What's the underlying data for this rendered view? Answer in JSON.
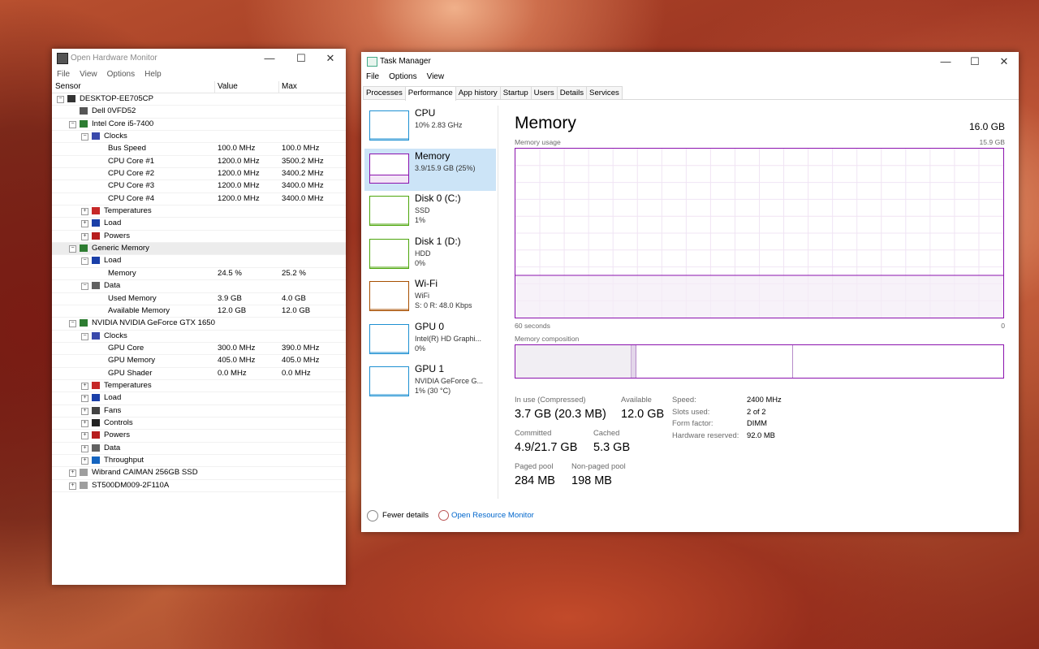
{
  "ohm": {
    "title": "Open Hardware Monitor",
    "menu": [
      "File",
      "View",
      "Options",
      "Help"
    ],
    "columns": {
      "sensor": "Sensor",
      "value": "Value",
      "max": "Max"
    },
    "rows": [
      {
        "label": "DESKTOP-EE705CP",
        "value": "",
        "max": "",
        "depth": 0,
        "exp": "⊟",
        "icon": "computer-icon",
        "color": "#333333"
      },
      {
        "label": "Dell 0VFD52",
        "value": "",
        "max": "",
        "depth": 1,
        "exp": "",
        "icon": "motherboard-icon",
        "color": "#555555"
      },
      {
        "label": "Intel Core i5-7400",
        "value": "",
        "max": "",
        "depth": 1,
        "exp": "⊟",
        "icon": "cpu-icon",
        "color": "#2e7d32"
      },
      {
        "label": "Clocks",
        "value": "",
        "max": "",
        "depth": 2,
        "exp": "⊟",
        "icon": "clock-icon",
        "color": "#3949ab"
      },
      {
        "label": "Bus Speed",
        "value": "100.0 MHz",
        "max": "100.0 MHz",
        "depth": 3,
        "exp": "",
        "icon": "",
        "color": ""
      },
      {
        "label": "CPU Core #1",
        "value": "1200.0 MHz",
        "max": "3500.2 MHz",
        "depth": 3,
        "exp": "",
        "icon": "",
        "color": ""
      },
      {
        "label": "CPU Core #2",
        "value": "1200.0 MHz",
        "max": "3400.2 MHz",
        "depth": 3,
        "exp": "",
        "icon": "",
        "color": ""
      },
      {
        "label": "CPU Core #3",
        "value": "1200.0 MHz",
        "max": "3400.0 MHz",
        "depth": 3,
        "exp": "",
        "icon": "",
        "color": ""
      },
      {
        "label": "CPU Core #4",
        "value": "1200.0 MHz",
        "max": "3400.0 MHz",
        "depth": 3,
        "exp": "",
        "icon": "",
        "color": ""
      },
      {
        "label": "Temperatures",
        "value": "",
        "max": "",
        "depth": 2,
        "exp": "⊞",
        "icon": "thermometer-icon",
        "color": "#c62828"
      },
      {
        "label": "Load",
        "value": "",
        "max": "",
        "depth": 2,
        "exp": "⊞",
        "icon": "load-icon",
        "color": "#1a3fa8"
      },
      {
        "label": "Powers",
        "value": "",
        "max": "",
        "depth": 2,
        "exp": "⊞",
        "icon": "power-icon",
        "color": "#b71c1c"
      },
      {
        "label": "Generic Memory",
        "value": "",
        "max": "",
        "depth": 1,
        "exp": "⊟",
        "icon": "ram-icon",
        "color": "#2e7d32",
        "selected": true
      },
      {
        "label": "Load",
        "value": "",
        "max": "",
        "depth": 2,
        "exp": "⊟",
        "icon": "load-icon",
        "color": "#1a3fa8"
      },
      {
        "label": "Memory",
        "value": "24.5 %",
        "max": "25.2 %",
        "depth": 3,
        "exp": "",
        "icon": "",
        "color": ""
      },
      {
        "label": "Data",
        "value": "",
        "max": "",
        "depth": 2,
        "exp": "⊟",
        "icon": "data-icon",
        "color": "#616161"
      },
      {
        "label": "Used Memory",
        "value": "3.9 GB",
        "max": "4.0 GB",
        "depth": 3,
        "exp": "",
        "icon": "",
        "color": ""
      },
      {
        "label": "Available Memory",
        "value": "12.0 GB",
        "max": "12.0 GB",
        "depth": 3,
        "exp": "",
        "icon": "",
        "color": ""
      },
      {
        "label": "NVIDIA NVIDIA GeForce GTX 1650",
        "value": "",
        "max": "",
        "depth": 1,
        "exp": "⊟",
        "icon": "gpu-icon",
        "color": "#2e7d32"
      },
      {
        "label": "Clocks",
        "value": "",
        "max": "",
        "depth": 2,
        "exp": "⊟",
        "icon": "clock-icon",
        "color": "#3949ab"
      },
      {
        "label": "GPU Core",
        "value": "300.0 MHz",
        "max": "390.0 MHz",
        "depth": 3,
        "exp": "",
        "icon": "",
        "color": ""
      },
      {
        "label": "GPU Memory",
        "value": "405.0 MHz",
        "max": "405.0 MHz",
        "depth": 3,
        "exp": "",
        "icon": "",
        "color": ""
      },
      {
        "label": "GPU Shader",
        "value": "0.0 MHz",
        "max": "0.0 MHz",
        "depth": 3,
        "exp": "",
        "icon": "",
        "color": ""
      },
      {
        "label": "Temperatures",
        "value": "",
        "max": "",
        "depth": 2,
        "exp": "⊞",
        "icon": "thermometer-icon",
        "color": "#c62828"
      },
      {
        "label": "Load",
        "value": "",
        "max": "",
        "depth": 2,
        "exp": "⊞",
        "icon": "load-icon",
        "color": "#1a3fa8"
      },
      {
        "label": "Fans",
        "value": "",
        "max": "",
        "depth": 2,
        "exp": "⊞",
        "icon": "fan-icon",
        "color": "#424242"
      },
      {
        "label": "Controls",
        "value": "",
        "max": "",
        "depth": 2,
        "exp": "⊞",
        "icon": "control-icon",
        "color": "#212121"
      },
      {
        "label": "Powers",
        "value": "",
        "max": "",
        "depth": 2,
        "exp": "⊞",
        "icon": "power-icon",
        "color": "#b71c1c"
      },
      {
        "label": "Data",
        "value": "",
        "max": "",
        "depth": 2,
        "exp": "⊞",
        "icon": "data-icon",
        "color": "#616161"
      },
      {
        "label": "Throughput",
        "value": "",
        "max": "",
        "depth": 2,
        "exp": "⊞",
        "icon": "throughput-icon",
        "color": "#1565c0"
      },
      {
        "label": "Wibrand CAIMAN 256GB SSD",
        "value": "",
        "max": "",
        "depth": 1,
        "exp": "⊞",
        "icon": "drive-icon",
        "color": "#9e9e9e"
      },
      {
        "label": "ST500DM009-2F110A",
        "value": "",
        "max": "",
        "depth": 1,
        "exp": "⊞",
        "icon": "drive-icon",
        "color": "#9e9e9e"
      }
    ]
  },
  "tm": {
    "title": "Task Manager",
    "menu": [
      "File",
      "Options",
      "View"
    ],
    "tabs": [
      "Processes",
      "Performance",
      "App history",
      "Startup",
      "Users",
      "Details",
      "Services"
    ],
    "active_tab": 1,
    "resources": [
      {
        "name": "CPU",
        "sub1": "10% 2.83 GHz",
        "sub2": "",
        "color": "#1e90d2",
        "active": false
      },
      {
        "name": "Memory",
        "sub1": "3.9/15.9 GB (25%)",
        "sub2": "",
        "color": "#8b12ae",
        "active": true
      },
      {
        "name": "Disk 0 (C:)",
        "sub1": "SSD",
        "sub2": "1%",
        "color": "#4da60c",
        "active": false
      },
      {
        "name": "Disk 1 (D:)",
        "sub1": "HDD",
        "sub2": "0%",
        "color": "#4da60c",
        "active": false
      },
      {
        "name": "Wi-Fi",
        "sub1": "WiFi",
        "sub2": "S: 0 R: 48.0 Kbps",
        "color": "#a74f01",
        "active": false
      },
      {
        "name": "GPU 0",
        "sub1": "Intel(R) HD Graphi...",
        "sub2": "0%",
        "color": "#1e90d2",
        "active": false
      },
      {
        "name": "GPU 1",
        "sub1": "NVIDIA GeForce G...",
        "sub2": "1% (30 °C)",
        "color": "#1e90d2",
        "active": false
      }
    ],
    "main": {
      "title": "Memory",
      "total": "16.0 GB",
      "usage_label": "Memory usage",
      "usage_max": "15.9 GB",
      "time_left": "60 seconds",
      "time_right": "0",
      "composition_label": "Memory composition",
      "usage_fraction": 0.25
    },
    "stats": {
      "in_use_label": "In use (Compressed)",
      "in_use": "3.7 GB (20.3 MB)",
      "available_label": "Available",
      "available": "12.0 GB",
      "committed_label": "Committed",
      "committed": "4.9/21.7 GB",
      "cached_label": "Cached",
      "cached": "5.3 GB",
      "paged_label": "Paged pool",
      "paged": "284 MB",
      "nonpaged_label": "Non-paged pool",
      "nonpaged": "198 MB"
    },
    "props": [
      {
        "k": "Speed:",
        "v": "2400 MHz"
      },
      {
        "k": "Slots used:",
        "v": "2 of 2"
      },
      {
        "k": "Form factor:",
        "v": "DIMM"
      },
      {
        "k": "Hardware reserved:",
        "v": "92.0 MB"
      }
    ],
    "footer": {
      "fewer": "Fewer details",
      "resmon": "Open Resource Monitor"
    },
    "accent": "#8b12ae",
    "link_color": "#0066cc"
  }
}
